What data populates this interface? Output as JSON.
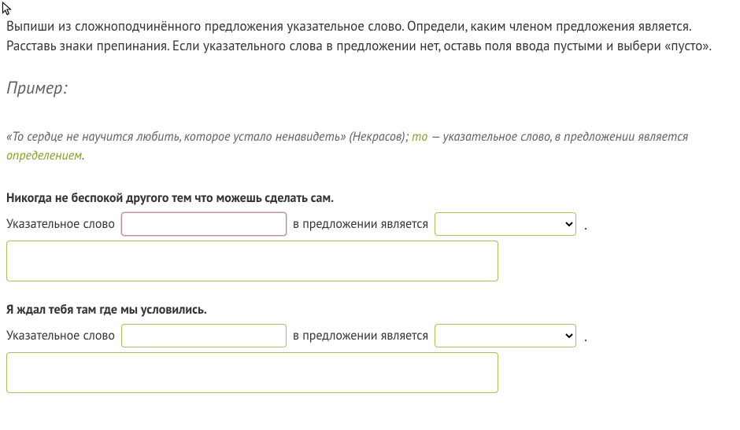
{
  "instructions": "Выпиши из сложноподчинённого предложения указательное слово. Определи, каким членом предложения является. Расставь знаки препинания. Если указательного слова в предложении нет, оставь поля ввода пустыми и выбери «пусто».",
  "example_heading": "Пример:",
  "example": {
    "quote": "«То сердце не научится любить, которое устало ненавидеть» (Некрасов); ",
    "word": "то",
    "mid": " — указательное слово, в предложении является ",
    "role": "определением",
    "tail": "."
  },
  "labels": {
    "demonstrative": "Указательное слово",
    "in_sentence": "в предложении является"
  },
  "tasks": [
    {
      "sentence": "Никогда не беспокой другого тем что можешь сделать сам.",
      "word_value": "",
      "role_value": "",
      "textarea_value": ""
    },
    {
      "sentence": "Я ждал тебя там где мы условились.",
      "word_value": "",
      "role_value": "",
      "textarea_value": ""
    }
  ],
  "select_options": [
    ""
  ]
}
